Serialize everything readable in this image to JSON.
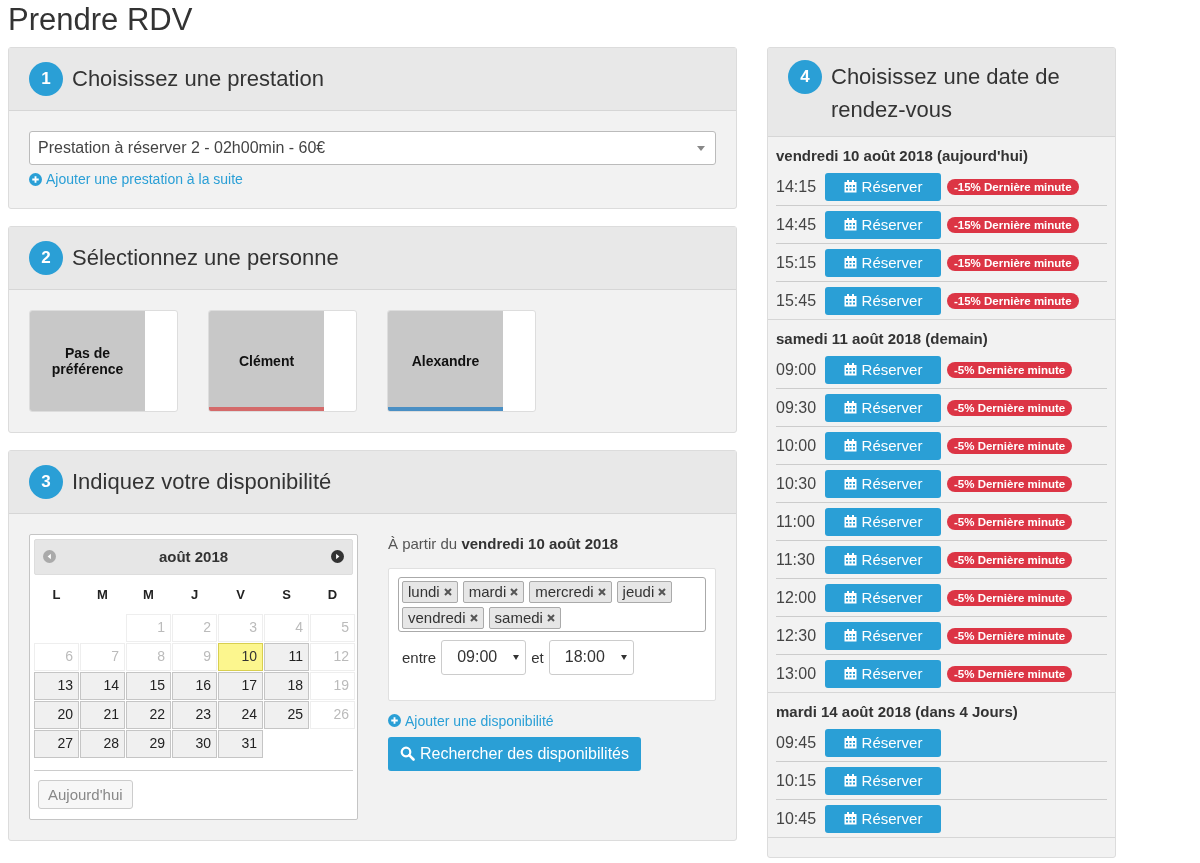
{
  "page_title": "Prendre RDV",
  "service": {
    "step": "1",
    "title": "Choisissez une prestation",
    "selected_value": "Prestation à réserver 2 - 02h00min - 60€",
    "add_link": "Ajouter une prestation à la suite"
  },
  "person": {
    "step": "2",
    "title": "Sélectionnez une personne",
    "options": [
      {
        "name": "Pas de préférence"
      },
      {
        "name": "Clément",
        "color": "#d46a6a"
      },
      {
        "name": "Alexandre",
        "color": "#4a8fc4"
      }
    ]
  },
  "availability": {
    "step": "3",
    "title": "Indiquez votre disponibilité",
    "calendar": {
      "month": "août 2018",
      "prev": {
        "disabled": true
      },
      "next": {
        "disabled": false
      },
      "weekdays": [
        "L",
        "M",
        "M",
        "J",
        "V",
        "S",
        "D"
      ],
      "weeks": [
        [
          {
            "kind": "empty"
          },
          {
            "kind": "empty"
          },
          {
            "kind": "day",
            "day": "1",
            "disabled": true,
            "today": false
          },
          {
            "kind": "day",
            "day": "2",
            "disabled": true,
            "today": false
          },
          {
            "kind": "day",
            "day": "3",
            "disabled": true,
            "today": false
          },
          {
            "kind": "day",
            "day": "4",
            "disabled": true,
            "today": false
          },
          {
            "kind": "day",
            "day": "5",
            "disabled": true,
            "today": false
          }
        ],
        [
          {
            "kind": "day",
            "day": "6",
            "disabled": true,
            "today": false
          },
          {
            "kind": "day",
            "day": "7",
            "disabled": true,
            "today": false
          },
          {
            "kind": "day",
            "day": "8",
            "disabled": true,
            "today": false
          },
          {
            "kind": "day",
            "day": "9",
            "disabled": true,
            "today": false
          },
          {
            "kind": "day",
            "day": "10",
            "disabled": false,
            "today": true
          },
          {
            "kind": "day",
            "day": "11",
            "disabled": false,
            "today": false
          },
          {
            "kind": "day",
            "day": "12",
            "disabled": true,
            "today": false
          }
        ],
        [
          {
            "kind": "day",
            "day": "13",
            "disabled": false,
            "today": false
          },
          {
            "kind": "day",
            "day": "14",
            "disabled": false,
            "today": false
          },
          {
            "kind": "day",
            "day": "15",
            "disabled": false,
            "today": false
          },
          {
            "kind": "day",
            "day": "16",
            "disabled": false,
            "today": false
          },
          {
            "kind": "day",
            "day": "17",
            "disabled": false,
            "today": false
          },
          {
            "kind": "day",
            "day": "18",
            "disabled": false,
            "today": false
          },
          {
            "kind": "day",
            "day": "19",
            "disabled": true,
            "today": false
          }
        ],
        [
          {
            "kind": "day",
            "day": "20",
            "disabled": false,
            "today": false
          },
          {
            "kind": "day",
            "day": "21",
            "disabled": false,
            "today": false
          },
          {
            "kind": "day",
            "day": "22",
            "disabled": false,
            "today": false
          },
          {
            "kind": "day",
            "day": "23",
            "disabled": false,
            "today": false
          },
          {
            "kind": "day",
            "day": "24",
            "disabled": false,
            "today": false
          },
          {
            "kind": "day",
            "day": "25",
            "disabled": false,
            "today": false
          },
          {
            "kind": "day",
            "day": "26",
            "disabled": true,
            "today": false
          }
        ],
        [
          {
            "kind": "day",
            "day": "27",
            "disabled": false,
            "today": false
          },
          {
            "kind": "day",
            "day": "28",
            "disabled": false,
            "today": false
          },
          {
            "kind": "day",
            "day": "29",
            "disabled": false,
            "today": false
          },
          {
            "kind": "day",
            "day": "30",
            "disabled": false,
            "today": false
          },
          {
            "kind": "day",
            "day": "31",
            "disabled": false,
            "today": false
          },
          {
            "kind": "empty"
          },
          {
            "kind": "empty"
          }
        ]
      ],
      "today_button": "Aujourd'hui"
    },
    "from_label": "À partir du **vendredi 10 août 2018**",
    "days": [
      "lundi",
      "mardi",
      "mercredi",
      "jeudi",
      "vendredi",
      "samedi"
    ],
    "between_label": "entre",
    "start": "09:00",
    "and_label": "et",
    "end": "18:00",
    "add_link": "Ajouter une disponibilité",
    "search_button": "Rechercher des disponibilités"
  },
  "appointments": {
    "step": "4",
    "title": "Choisissez une date de rendez-vous",
    "days": [
      {
        "date": "vendredi 10 août 2018 (aujourd'hui)",
        "slots": [
          {
            "time": "14:15",
            "button": "Réserver",
            "badge": "-15% Dernière minute"
          },
          {
            "time": "14:45",
            "button": "Réserver",
            "badge": "-15% Dernière minute"
          },
          {
            "time": "15:15",
            "button": "Réserver",
            "badge": "-15% Dernière minute"
          },
          {
            "time": "15:45",
            "button": "Réserver",
            "badge": "-15% Dernière minute"
          }
        ]
      },
      {
        "date": "samedi 11 août 2018 (demain)",
        "slots": [
          {
            "time": "09:00",
            "button": "Réserver",
            "badge": "-5% Dernière minute"
          },
          {
            "time": "09:30",
            "button": "Réserver",
            "badge": "-5% Dernière minute"
          },
          {
            "time": "10:00",
            "button": "Réserver",
            "badge": "-5% Dernière minute"
          },
          {
            "time": "10:30",
            "button": "Réserver",
            "badge": "-5% Dernière minute"
          },
          {
            "time": "11:00",
            "button": "Réserver",
            "badge": "-5% Dernière minute"
          },
          {
            "time": "11:30",
            "button": "Réserver",
            "badge": "-5% Dernière minute"
          },
          {
            "time": "12:00",
            "button": "Réserver",
            "badge": "-5% Dernière minute"
          },
          {
            "time": "12:30",
            "button": "Réserver",
            "badge": "-5% Dernière minute"
          },
          {
            "time": "13:00",
            "button": "Réserver",
            "badge": "-5% Dernière minute"
          }
        ]
      },
      {
        "date": "mardi 14 août 2018 (dans 4 Jours)",
        "slots": [
          {
            "time": "09:45",
            "button": "Réserver"
          },
          {
            "time": "10:15",
            "button": "Réserver"
          },
          {
            "time": "10:45",
            "button": "Réserver"
          }
        ]
      }
    ]
  }
}
